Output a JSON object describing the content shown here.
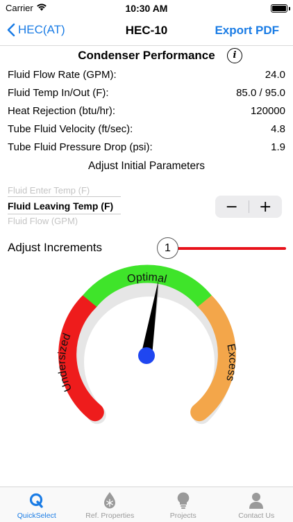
{
  "status": {
    "carrier": "Carrier",
    "time": "10:30 AM"
  },
  "nav": {
    "back_label": "HEC(AT)",
    "title": "HEC-10",
    "action_label": "Export PDF"
  },
  "performance": {
    "title": "Condenser Performance",
    "info_icon": "i",
    "rows": [
      {
        "label": "Fluid Flow Rate (GPM):",
        "value": "24.0"
      },
      {
        "label": "Fluid Temp In/Out (F):",
        "value": "85.0 / 95.0"
      },
      {
        "label": "Heat Rejection (btu/hr):",
        "value": "120000"
      },
      {
        "label": "Tube Fluid Velocity (ft/sec):",
        "value": "4.8"
      },
      {
        "label": "Tube Fluid Pressure Drop (psi):",
        "value": "1.9"
      }
    ]
  },
  "adjust": {
    "title": "Adjust Initial Parameters",
    "picker": {
      "prev": "Fluid Enter Temp (F)",
      "selected": "Fluid Leaving Temp (F)",
      "next": "Fluid Flow (GPM)"
    },
    "stepper": {
      "minus": "−",
      "plus": "+"
    }
  },
  "increments": {
    "label": "Adjust Increments",
    "value": "1"
  },
  "gauge": {
    "labels": {
      "low": "Undersized",
      "mid": "Optimal",
      "high": "Excess"
    },
    "colors": {
      "low": "#ee1c1c",
      "mid": "#3fe42a",
      "high": "#f3a64a",
      "needle": "#000000",
      "hub": "#1f46f0"
    },
    "needle_angle_deg": 9
  },
  "tabs": [
    {
      "label": "QuickSelect",
      "icon": "quickselect-q-icon",
      "active": true
    },
    {
      "label": "Ref. Properties",
      "icon": "snowflake-drop-icon",
      "active": false
    },
    {
      "label": "Projects",
      "icon": "lightbulb-icon",
      "active": false
    },
    {
      "label": "Contact Us",
      "icon": "person-icon",
      "active": false
    }
  ]
}
